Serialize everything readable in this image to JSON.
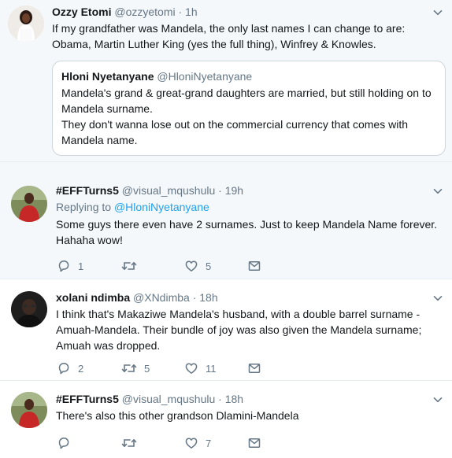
{
  "tweets": [
    {
      "name": "Ozzy Etomi",
      "handle": "@ozzyetomi",
      "dot": "·",
      "time": "1h",
      "text": "If my grandfather was Mandela, the only last names I can change to are: Obama, Martin Luther King (yes the full thing), Winfrey & Knowles.",
      "avatar_icon": "avatar-woman-white-dress",
      "quote": {
        "name": "Hloni Nyetanyane",
        "handle": "@HloniNyetanyane",
        "text": "Mandela's grand & great-grand daughters are married, but still holding on to Mandela surname.",
        "text2": "They don't wanna lose out on the commercial currency that comes with Mandela name."
      }
    },
    {
      "name": "#EFFTurns5",
      "handle": "@visual_mqushulu",
      "dot": "·",
      "time": "19h",
      "replying_prefix": "Replying to",
      "replying_handle": "@HloniNyetanyane",
      "text": "Some guys there even have 2 surnames.  Just to keep Mandela Name forever. Hahaha wow!",
      "reply_count": "1",
      "retweet_count": "",
      "like_count": "5"
    },
    {
      "name": "xolani ndimba",
      "handle": "@XNdimba",
      "dot": "·",
      "time": "18h",
      "text": "I think that's Makaziwe Mandela's husband, with a double barrel surname - Amuah-Mandela. Their bundle of joy was also given the Mandela surname; Amuah was dropped.",
      "reply_count": "2",
      "retweet_count": "5",
      "like_count": "11"
    },
    {
      "name": "#EFFTurns5",
      "handle": "@visual_mqushulu",
      "dot": "·",
      "time": "18h",
      "text": "There's also this other grandson Dlamini-Mandela",
      "reply_count": "",
      "retweet_count": "",
      "like_count": "7"
    }
  ],
  "colors": {
    "link": "#1da1f2",
    "muted": "#657786",
    "highlight_bg": "#f5f8fa",
    "border": "#e6ecf0"
  },
  "icons": [
    "chevron-down-icon",
    "reply-icon",
    "retweet-icon",
    "like-icon",
    "message-icon"
  ]
}
